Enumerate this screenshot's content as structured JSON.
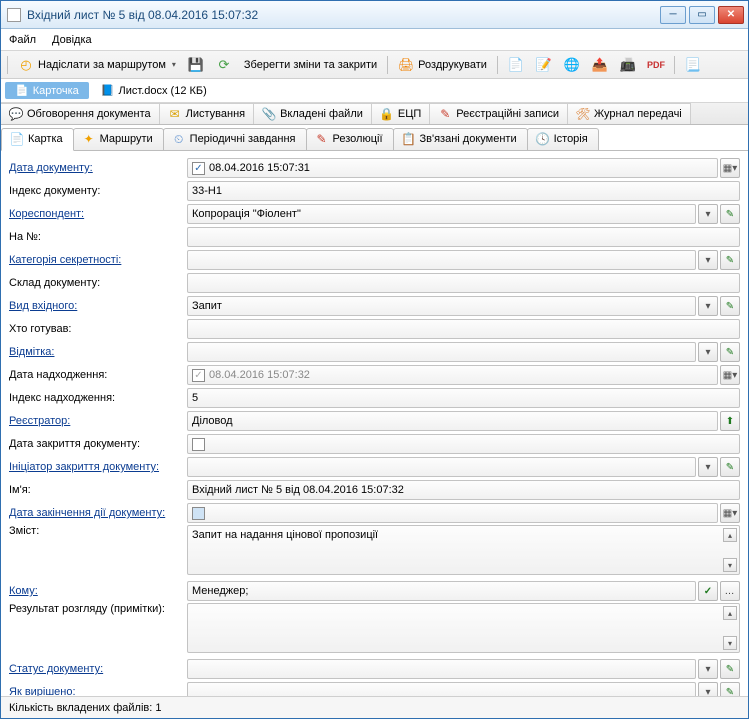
{
  "window": {
    "title": "Вхідний лист № 5 від 08.04.2016 15:07:32"
  },
  "menu": {
    "file": "Файл",
    "help": "Довідка"
  },
  "toolbar": {
    "send_route": "Надіслати за маршрутом",
    "save_close": "Зберегти зміни та закрити",
    "print": "Роздрукувати"
  },
  "attachments": {
    "card_label": "Карточка",
    "doc_label": "Лист.docx (12 КБ)"
  },
  "upper_tabs": {
    "discussion": "Обговорення документа",
    "mailing": "Листування",
    "attachments": "Вкладені файли",
    "sign": "ЕЦП",
    "reg": "Реєстраційні записи",
    "journal": "Журнал передачі"
  },
  "lower_tabs": {
    "card": "Картка",
    "routes": "Маршрути",
    "periodic": "Періодичні завдання",
    "resolutions": "Резолюції",
    "linked": "Зв'язані документи",
    "history": "Історія"
  },
  "labels": {
    "doc_date": "Дата документу:",
    "doc_index": "Індекс документу:",
    "correspondent": "Кореспондент:",
    "on_no": "На №:",
    "secrecy": "Категорія секретності:",
    "composition": "Склад документу:",
    "incoming_type": "Вид вхідного:",
    "prepared_by": "Хто готував:",
    "mark": "Відмітка:",
    "arrival_date": "Дата надходження:",
    "arrival_index": "Індекс надходження:",
    "registrar": "Реєстратор:",
    "close_date": "Дата закриття документу:",
    "close_initiator": "Ініціатор закриття документу:",
    "name": "Ім'я:",
    "expiry": "Дата закінчення дії документу:",
    "content": "Зміст:",
    "to_whom": "Кому:",
    "result": "Результат розгляду (примітки):",
    "status": "Статус документу:",
    "resolved": "Як вирішено:"
  },
  "values": {
    "doc_date": "08.04.2016 15:07:31",
    "doc_index": "33-Н1",
    "correspondent": "Копрорація \"Фіолент\"",
    "on_no": "",
    "secrecy": "",
    "composition": "",
    "incoming_type": "Запит",
    "prepared_by": "",
    "mark": "",
    "arrival_date": "08.04.2016 15:07:32",
    "arrival_index": "5",
    "registrar": "Діловод",
    "close_date": "",
    "close_initiator": "",
    "name": "Вхідний лист № 5 від 08.04.2016 15:07:32",
    "expiry": "",
    "content": "Запит на надання цінової пропозиції",
    "to_whom": "Менеджер;",
    "result": "",
    "status": "",
    "resolved": ""
  },
  "status_bar": "Кількість вкладених файлів: 1"
}
